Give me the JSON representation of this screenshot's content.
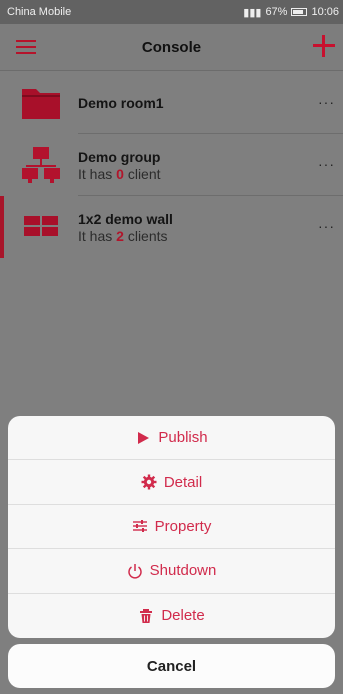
{
  "status_bar": {
    "carrier": "China Mobile",
    "battery": "67%",
    "time": "10:06"
  },
  "app_bar": {
    "title": "Console"
  },
  "rooms": [
    {
      "name": "Demo room1",
      "sub_prefix": "",
      "count": "",
      "sub_suffix": "",
      "icon": "folder-icon",
      "more": "···"
    },
    {
      "name": "Demo group",
      "sub_prefix": "It has ",
      "count": "0",
      "sub_suffix": " client",
      "icon": "network-group-icon",
      "more": "···"
    },
    {
      "name": "1x2 demo wall",
      "sub_prefix": "It has ",
      "count": "2",
      "sub_suffix": " clients",
      "icon": "video-wall-icon",
      "more": "···"
    }
  ],
  "action_sheet": {
    "actions": [
      {
        "label": "Publish",
        "icon": "play-icon"
      },
      {
        "label": "Detail",
        "icon": "gear-icon"
      },
      {
        "label": "Property",
        "icon": "sliders-icon"
      },
      {
        "label": "Shutdown",
        "icon": "power-icon"
      },
      {
        "label": "Delete",
        "icon": "trash-icon"
      }
    ],
    "cancel_label": "Cancel"
  },
  "colors": {
    "accent": "#c8102e",
    "action_text": "#d12b4c"
  }
}
